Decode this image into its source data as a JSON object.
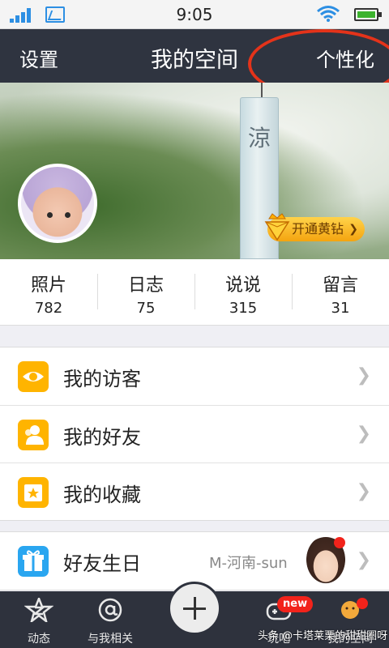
{
  "status_bar": {
    "time": "9:05",
    "icons": [
      "signal-icon",
      "gallery-icon",
      "wifi-icon",
      "battery-icon"
    ]
  },
  "header": {
    "left": "设置",
    "title": "我的空间",
    "right": "个性化"
  },
  "cover": {
    "chime_glyph": "涼",
    "vip_button": "开通黄钻"
  },
  "stats": [
    {
      "label": "照片",
      "value": "782"
    },
    {
      "label": "日志",
      "value": "75"
    },
    {
      "label": "说说",
      "value": "315"
    },
    {
      "label": "留言",
      "value": "31"
    }
  ],
  "menu": [
    {
      "icon": "eye-icon",
      "label": "我的访客"
    },
    {
      "icon": "friends-icon",
      "label": "我的好友"
    },
    {
      "icon": "star-folder-icon",
      "label": "我的收藏"
    }
  ],
  "birthday": {
    "icon": "gift-icon",
    "label": "好友生日",
    "friend": "M-河南-sun"
  },
  "tabbar": [
    {
      "icon": "dynamic-icon",
      "label": "动态"
    },
    {
      "icon": "at-icon",
      "label": "与我相关"
    },
    {
      "icon": "gamepad-icon",
      "label": "玩吧"
    },
    {
      "icon": "my-icon",
      "label": "我的空间"
    }
  ],
  "badge_new": "new",
  "watermark": "头条 @卡塔莱栗的甜甜圈呀",
  "colors": {
    "header_bg": "#2f3440",
    "tabbar_bg": "#2e323d",
    "accent_yellow": "#ffb400",
    "accent_blue": "#2aa6f0",
    "annotation_red": "#e4331a"
  }
}
